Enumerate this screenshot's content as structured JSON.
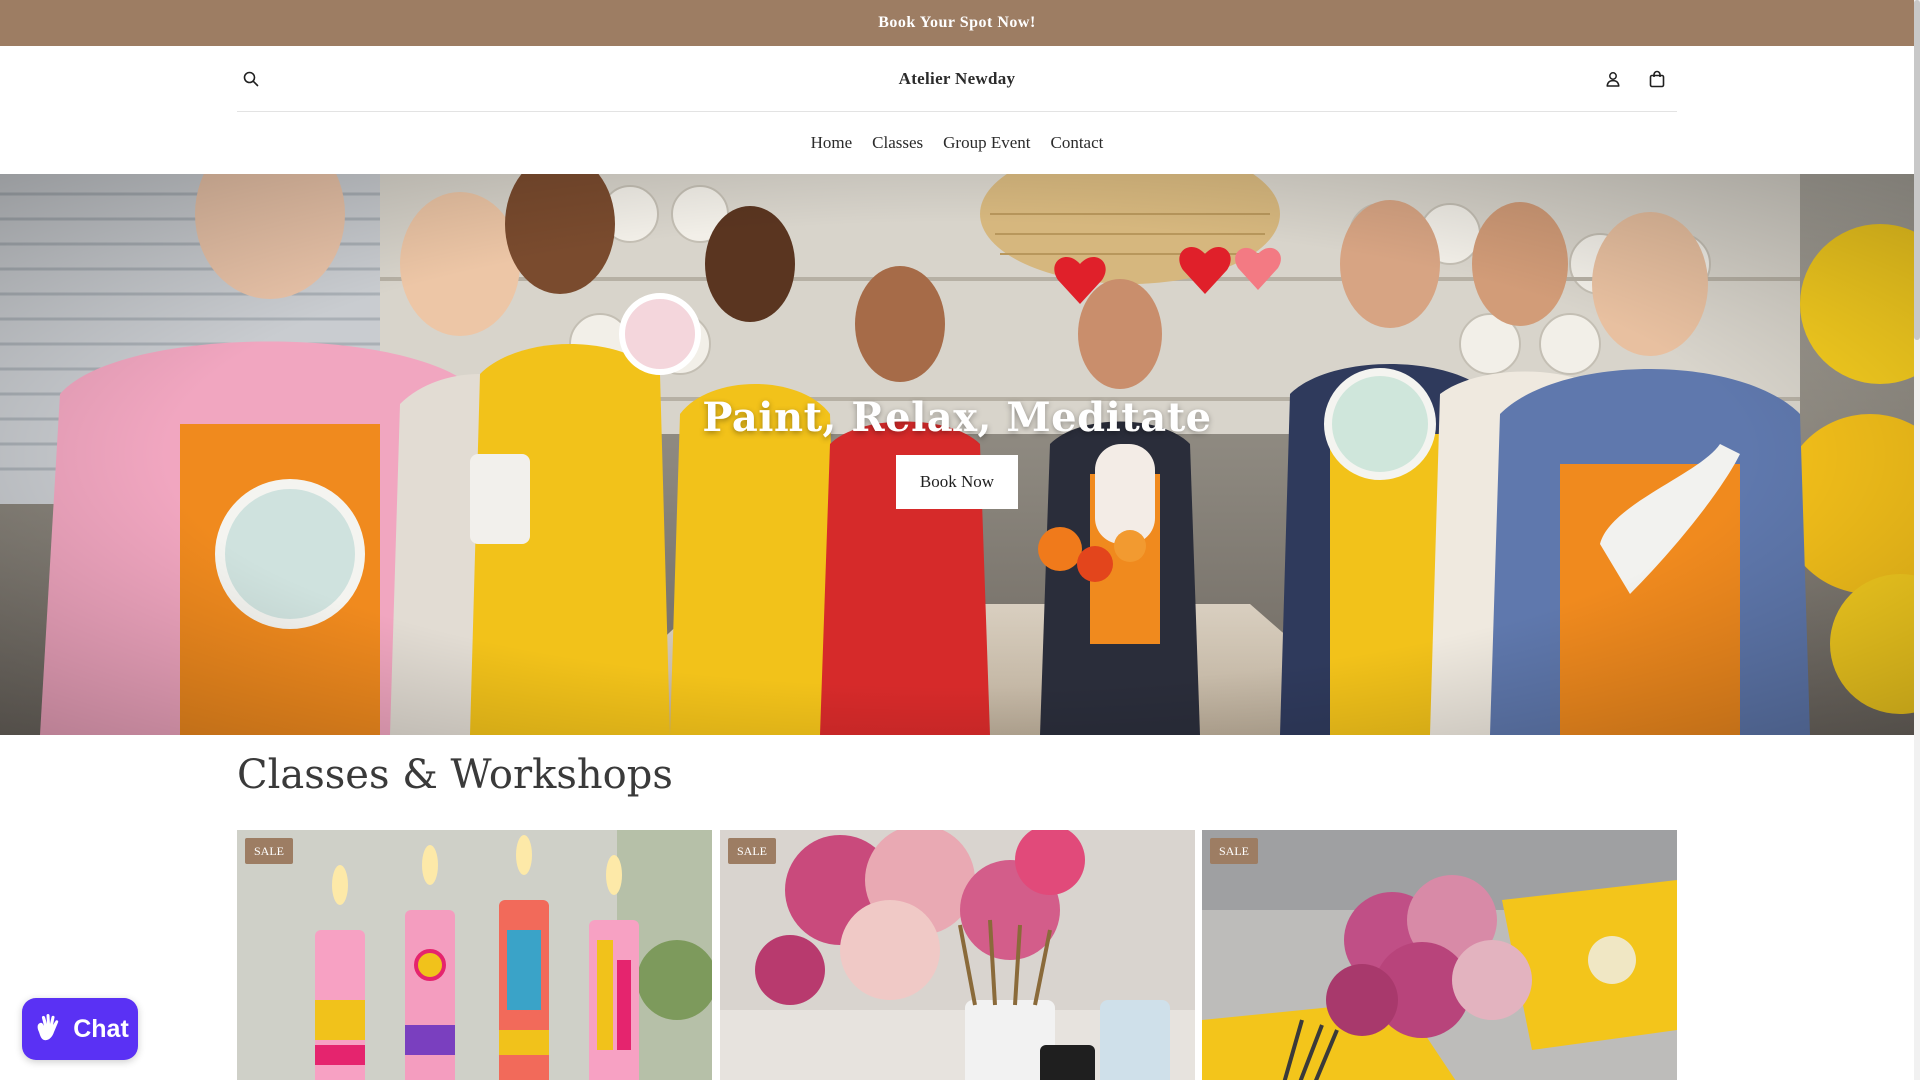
{
  "announcement": {
    "text": "Book Your Spot Now!"
  },
  "header": {
    "brand": "Atelier Newday",
    "icons": [
      "search-icon",
      "account-icon",
      "cart-icon"
    ]
  },
  "nav": {
    "items": [
      {
        "label": "Home"
      },
      {
        "label": "Classes"
      },
      {
        "label": "Group Event"
      },
      {
        "label": "Contact"
      }
    ]
  },
  "hero": {
    "title": "Paint, Relax, Meditate",
    "button_label": "Book Now"
  },
  "section": {
    "title": "Classes & Workshops",
    "cards": [
      {
        "badge": "SALE"
      },
      {
        "badge": "SALE"
      },
      {
        "badge": "SALE"
      }
    ]
  },
  "chat": {
    "label": "Chat"
  },
  "colors": {
    "brand": "#9d7d63",
    "chat": "#5a31f4",
    "apron_orange": "#f08a1e",
    "apron_yellow": "#f2c21a"
  }
}
